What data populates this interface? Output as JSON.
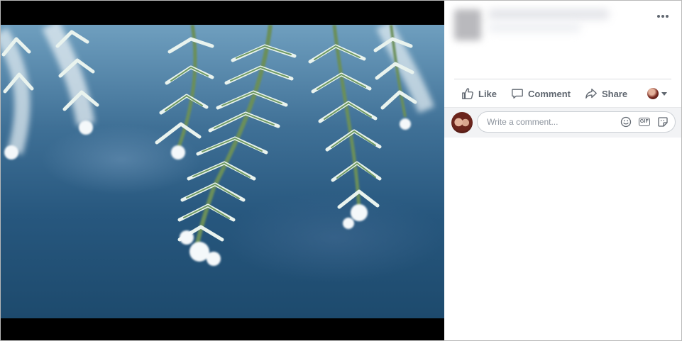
{
  "post": {
    "actions": {
      "like_label": "Like",
      "comment_label": "Comment",
      "share_label": "Share"
    },
    "comment_input": {
      "placeholder": "Write a comment..."
    },
    "icons": {
      "more": "more-horizontal-icon",
      "like": "thumbs-up-icon",
      "comment": "speech-bubble-icon",
      "share": "share-arrow-icon",
      "emoji": "smiley-icon",
      "gif": "gif-icon",
      "sticker": "sticker-icon",
      "caret": "chevron-down-icon"
    },
    "gif_text": "GIF"
  },
  "colors": {
    "action_text": "#606770",
    "comment_bg": "#f2f3f5",
    "divider": "#dadde1"
  }
}
